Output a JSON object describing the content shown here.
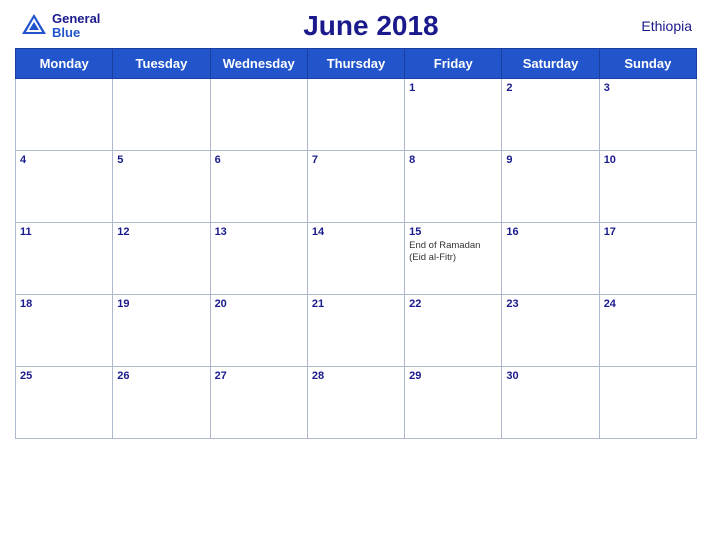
{
  "header": {
    "title": "June 2018",
    "country": "Ethiopia",
    "logo_line1": "General",
    "logo_line2": "Blue"
  },
  "days_of_week": [
    "Monday",
    "Tuesday",
    "Wednesday",
    "Thursday",
    "Friday",
    "Saturday",
    "Sunday"
  ],
  "weeks": [
    [
      {
        "day": "",
        "event": ""
      },
      {
        "day": "",
        "event": ""
      },
      {
        "day": "",
        "event": ""
      },
      {
        "day": "",
        "event": ""
      },
      {
        "day": "1",
        "event": ""
      },
      {
        "day": "2",
        "event": ""
      },
      {
        "day": "3",
        "event": ""
      }
    ],
    [
      {
        "day": "4",
        "event": ""
      },
      {
        "day": "5",
        "event": ""
      },
      {
        "day": "6",
        "event": ""
      },
      {
        "day": "7",
        "event": ""
      },
      {
        "day": "8",
        "event": ""
      },
      {
        "day": "9",
        "event": ""
      },
      {
        "day": "10",
        "event": ""
      }
    ],
    [
      {
        "day": "11",
        "event": ""
      },
      {
        "day": "12",
        "event": ""
      },
      {
        "day": "13",
        "event": ""
      },
      {
        "day": "14",
        "event": ""
      },
      {
        "day": "15",
        "event": "End of Ramadan (Eid al-Fitr)"
      },
      {
        "day": "16",
        "event": ""
      },
      {
        "day": "17",
        "event": ""
      }
    ],
    [
      {
        "day": "18",
        "event": ""
      },
      {
        "day": "19",
        "event": ""
      },
      {
        "day": "20",
        "event": ""
      },
      {
        "day": "21",
        "event": ""
      },
      {
        "day": "22",
        "event": ""
      },
      {
        "day": "23",
        "event": ""
      },
      {
        "day": "24",
        "event": ""
      }
    ],
    [
      {
        "day": "25",
        "event": ""
      },
      {
        "day": "26",
        "event": ""
      },
      {
        "day": "27",
        "event": ""
      },
      {
        "day": "28",
        "event": ""
      },
      {
        "day": "29",
        "event": ""
      },
      {
        "day": "30",
        "event": ""
      },
      {
        "day": "",
        "event": ""
      }
    ]
  ]
}
